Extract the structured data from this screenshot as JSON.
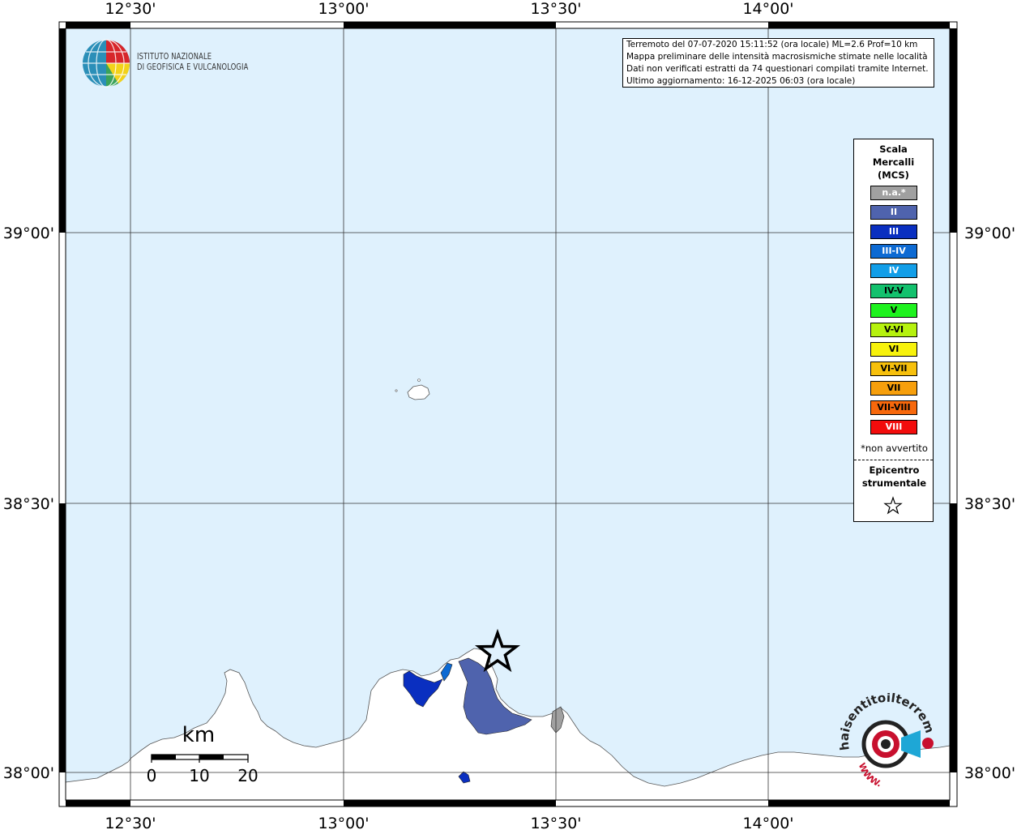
{
  "map": {
    "lon_labels": [
      "12°30'",
      "13°00'",
      "13°30'",
      "14°00'"
    ],
    "lat_labels": [
      "39°00'",
      "38°30'",
      "38°00'"
    ],
    "colors": {
      "sea": "#dff1fd",
      "land": "#ffffff",
      "intensity_II": "#4f63ad",
      "intensity_III": "#0a2fc0",
      "intensity_IIIIV": "#0d6ad3",
      "na": "#a0a0a0"
    }
  },
  "logo": {
    "line1": "ISTITUTO NAZIONALE",
    "line2": "DI GEOFISICA E VULCANOLOGIA"
  },
  "info_box": {
    "line1": "Terremoto del 07-07-2020 15:11:52 (ora locale) ML=2.6 Prof=10 km",
    "line2": "Mappa preliminare delle intensità macrosismiche stimate nelle località",
    "line3": "Dati non verificati estratti da 74 questionari compilati tramite Internet.",
    "line4": "Ultimo aggiornamento: 16-12-2025 06:03 (ora locale)"
  },
  "legend": {
    "title_line1": "Scala",
    "title_line2": "Mercalli",
    "title_line3": "(MCS)",
    "items": [
      {
        "label": "n.a.*",
        "color": "#a0a0a0",
        "text_color": "#ffffff"
      },
      {
        "label": "II",
        "color": "#4f63ad",
        "text_color": "#ffffff"
      },
      {
        "label": "III",
        "color": "#0a2fc0",
        "text_color": "#ffffff"
      },
      {
        "label": "III-IV",
        "color": "#0d6ad3",
        "text_color": "#ffffff"
      },
      {
        "label": "IV",
        "color": "#129ee8",
        "text_color": "#ffffff"
      },
      {
        "label": "IV-V",
        "color": "#13c16d",
        "text_color": "#000000"
      },
      {
        "label": "V",
        "color": "#1ef21e",
        "text_color": "#000000"
      },
      {
        "label": "V-VI",
        "color": "#b6f20e",
        "text_color": "#000000"
      },
      {
        "label": "VI",
        "color": "#f7f20c",
        "text_color": "#000000"
      },
      {
        "label": "VI-VII",
        "color": "#f7c00c",
        "text_color": "#000000"
      },
      {
        "label": "VII",
        "color": "#f79f0c",
        "text_color": "#000000"
      },
      {
        "label": "VII-VIII",
        "color": "#f7680c",
        "text_color": "#000000"
      },
      {
        "label": "VIII",
        "color": "#f20c0c",
        "text_color": "#ffffff"
      }
    ],
    "note": "*non avvertito",
    "epicenter_line1": "Epicentro",
    "epicenter_line2": "strumentale"
  },
  "scale_bar": {
    "unit": "km",
    "ticks": [
      "0",
      "10",
      "20"
    ]
  },
  "watermark": {
    "text": "haisentitoilterremoto.it",
    "url": "WWW."
  }
}
